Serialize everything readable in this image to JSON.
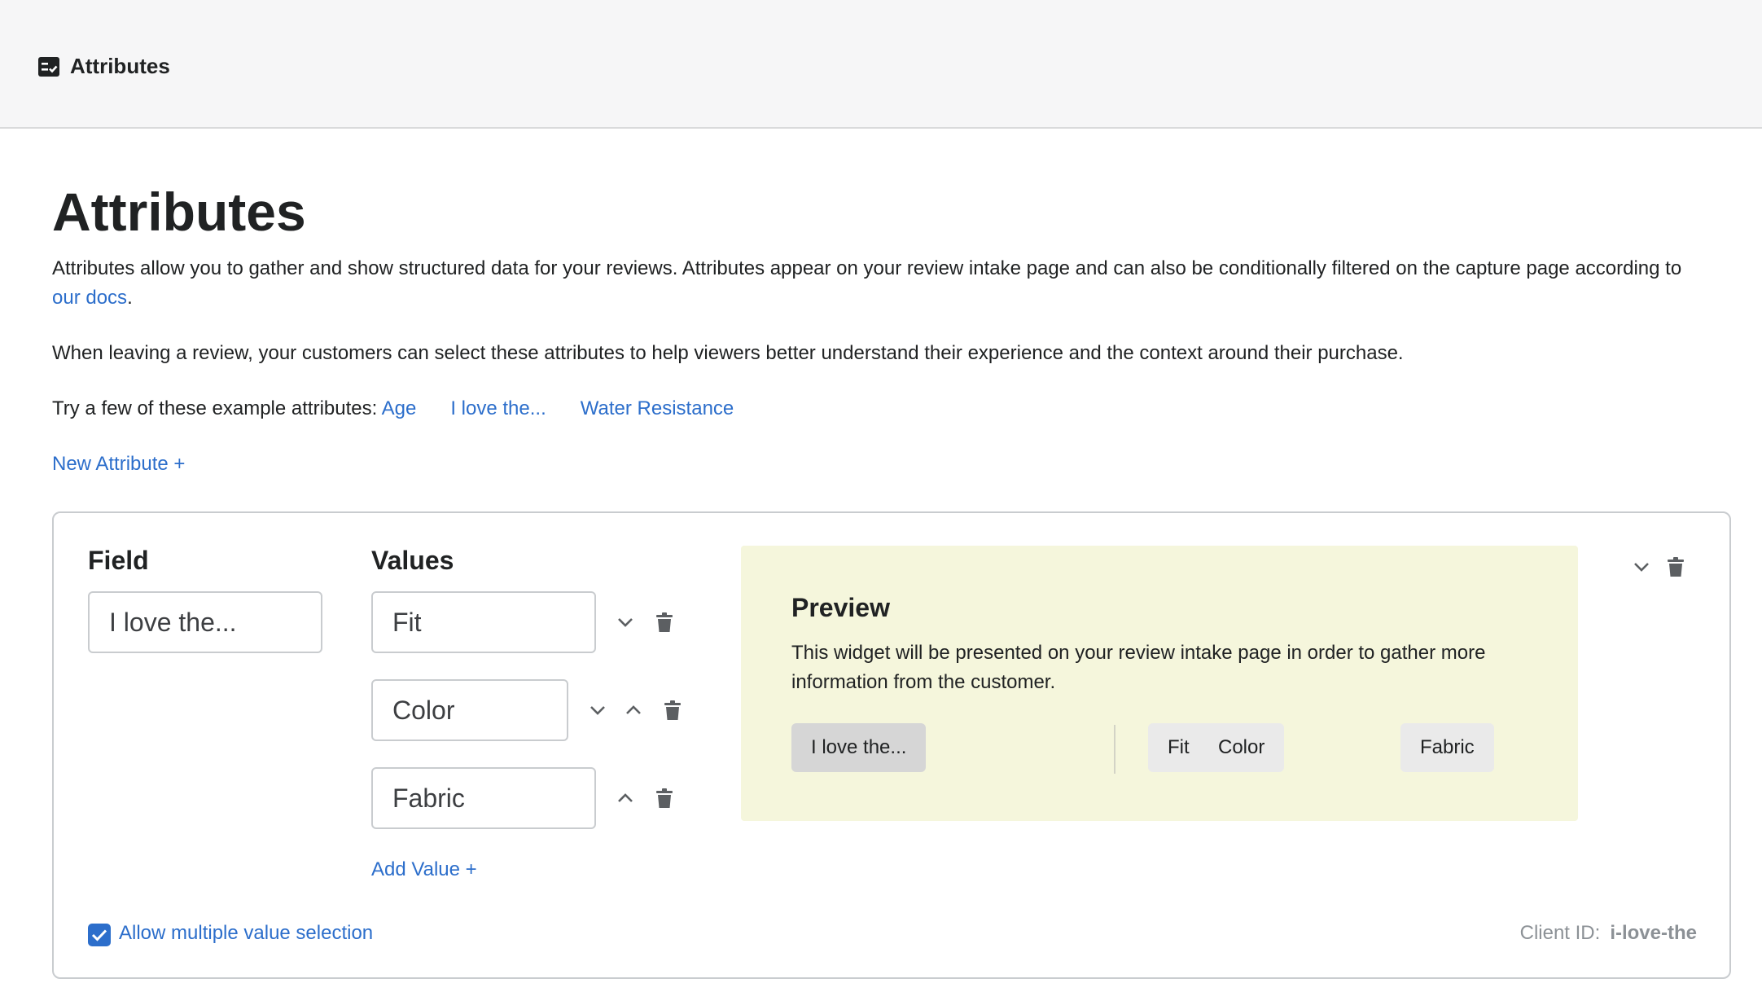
{
  "header": {
    "title": "Attributes",
    "icon": "checklist-icon"
  },
  "page": {
    "title": "Attributes",
    "intro_text": "Attributes allow you to gather and show structured data for your reviews. Attributes appear on your review intake page and can also be conditionally filtered on the capture page according to ",
    "docs_link": "our docs",
    "intro_end": ".",
    "context_text": "When leaving a review, your customers can select these attributes to help viewers better understand their experience and the context around their purchase.",
    "examples_label": "Try a few of these example attributes: ",
    "examples": [
      "Age",
      "I love the...",
      "Water Resistance"
    ],
    "new_attribute": "New Attribute +"
  },
  "attribute": {
    "field_label": "Field",
    "values_label": "Values",
    "field_value": "I love the...",
    "values": [
      "Fit",
      "Color",
      "Fabric"
    ],
    "add_value": "Add Value +",
    "allow_multiple_label": "Allow multiple value selection",
    "allow_multiple_checked": true,
    "client_id_label": "Client ID:",
    "client_id_value": "i-love-the"
  },
  "preview": {
    "title": "Preview",
    "description": "This widget will be presented on your review intake page in order to gather more information from the customer.",
    "field_pill": "I love the...",
    "value_pills": [
      "Fit",
      "Color",
      "Fabric"
    ]
  },
  "colors": {
    "link": "#2c6ecb",
    "preview_bg": "#f5f6dc",
    "topbar_bg": "#f6f6f7",
    "icon": "#5c5f62"
  }
}
